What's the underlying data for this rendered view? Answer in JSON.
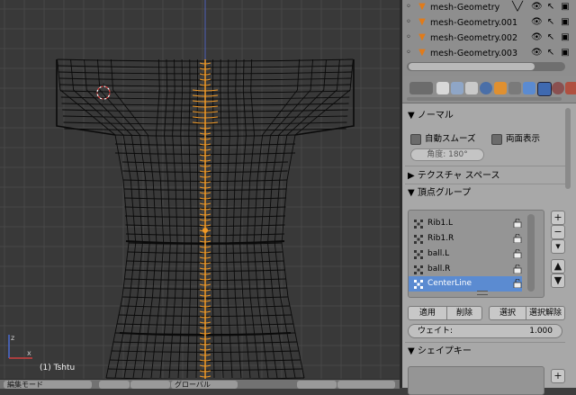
{
  "viewport": {
    "object_label": "(1) Tshtu"
  },
  "bottom_bar": {
    "mode_label": "編集モード",
    "global_label": "グローバル"
  },
  "outliner": {
    "rows": [
      {
        "name": "mesh-Geometry"
      },
      {
        "name": "mesh-Geometry.001"
      },
      {
        "name": "mesh-Geometry.002"
      },
      {
        "name": "mesh-Geometry.003"
      }
    ]
  },
  "properties": {
    "normals_header": "ノーマル",
    "auto_smooth_label": "自動スムーズ",
    "double_sided_label": "両面表示",
    "angle_field": "角度:    180°",
    "texture_space_header": "テクスチャ スペース",
    "vertex_groups_header": "頂点グループ",
    "vertex_groups": [
      {
        "name": "Rib1.L",
        "selected": false
      },
      {
        "name": "Rib1.R",
        "selected": false
      },
      {
        "name": "ball.L",
        "selected": false
      },
      {
        "name": "ball.R",
        "selected": false
      },
      {
        "name": "CenterLine",
        "selected": true
      }
    ],
    "assign_label": "適用",
    "remove_label": "削除",
    "select_label": "選択",
    "deselect_label": "選択解除",
    "weight_label": "ウェイト:",
    "weight_value": "1.000",
    "shape_keys_header": "シェイプキー"
  },
  "colors": {
    "selection": "#5b8bd1",
    "mesh_orange": "#f29a26",
    "viewport_bg": "#393939",
    "panel_bg": "#a8a8a8"
  }
}
